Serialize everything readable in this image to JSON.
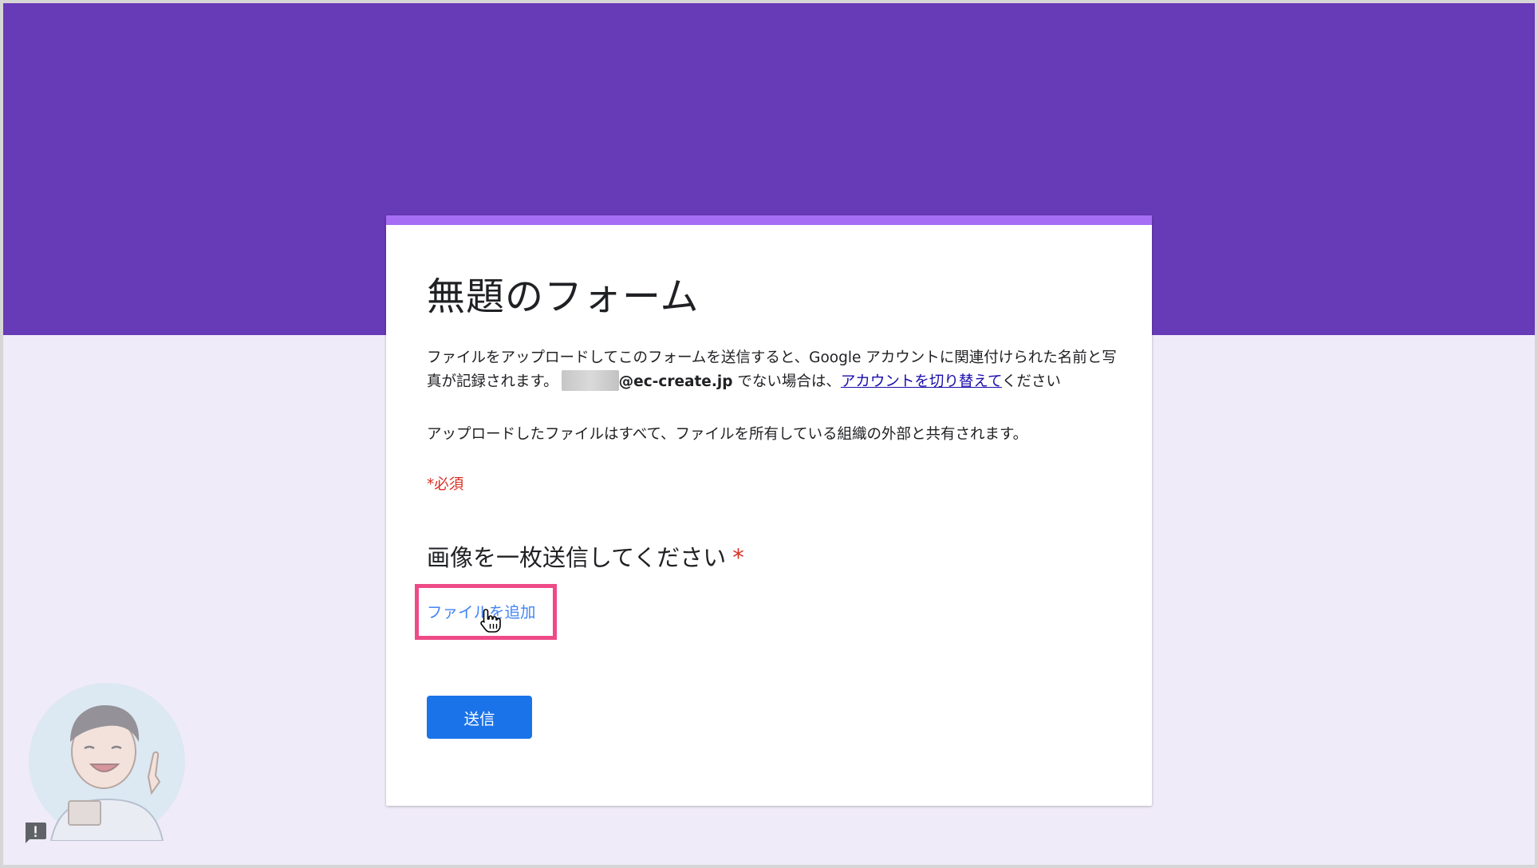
{
  "form": {
    "title": "無題のフォーム",
    "description_prefix": "ファイルをアップロードしてこのフォームを送信すると、Google アカウントに関連付けられた名前と写真が記録されます。",
    "email_domain": "@ec-create.jp",
    "description_middle": " でない場合は、",
    "switch_account_link": "アカウントを切り替えて",
    "description_suffix": "ください",
    "share_note": "アップロードしたファイルはすべて、ファイルを所有している組織の外部と共有されます。",
    "required_note": "*必須"
  },
  "question": {
    "title": "画像を一枚送信してください",
    "required_marker": "*",
    "add_file_label": "ファイルを追加"
  },
  "actions": {
    "submit_label": "送信"
  },
  "colors": {
    "header_bg": "#673ab7",
    "page_bg": "#f0ebf8",
    "card_accent": "#a56ef4",
    "required_red": "#d93025",
    "link_blue": "#1a0dab",
    "add_file_blue": "#4285f4",
    "submit_bg": "#1a73e8",
    "highlight_pink": "#ee4a87"
  },
  "icons": {
    "cursor": "hand-pointer-icon",
    "feedback": "feedback-icon",
    "mascot": "mascot-avatar"
  }
}
